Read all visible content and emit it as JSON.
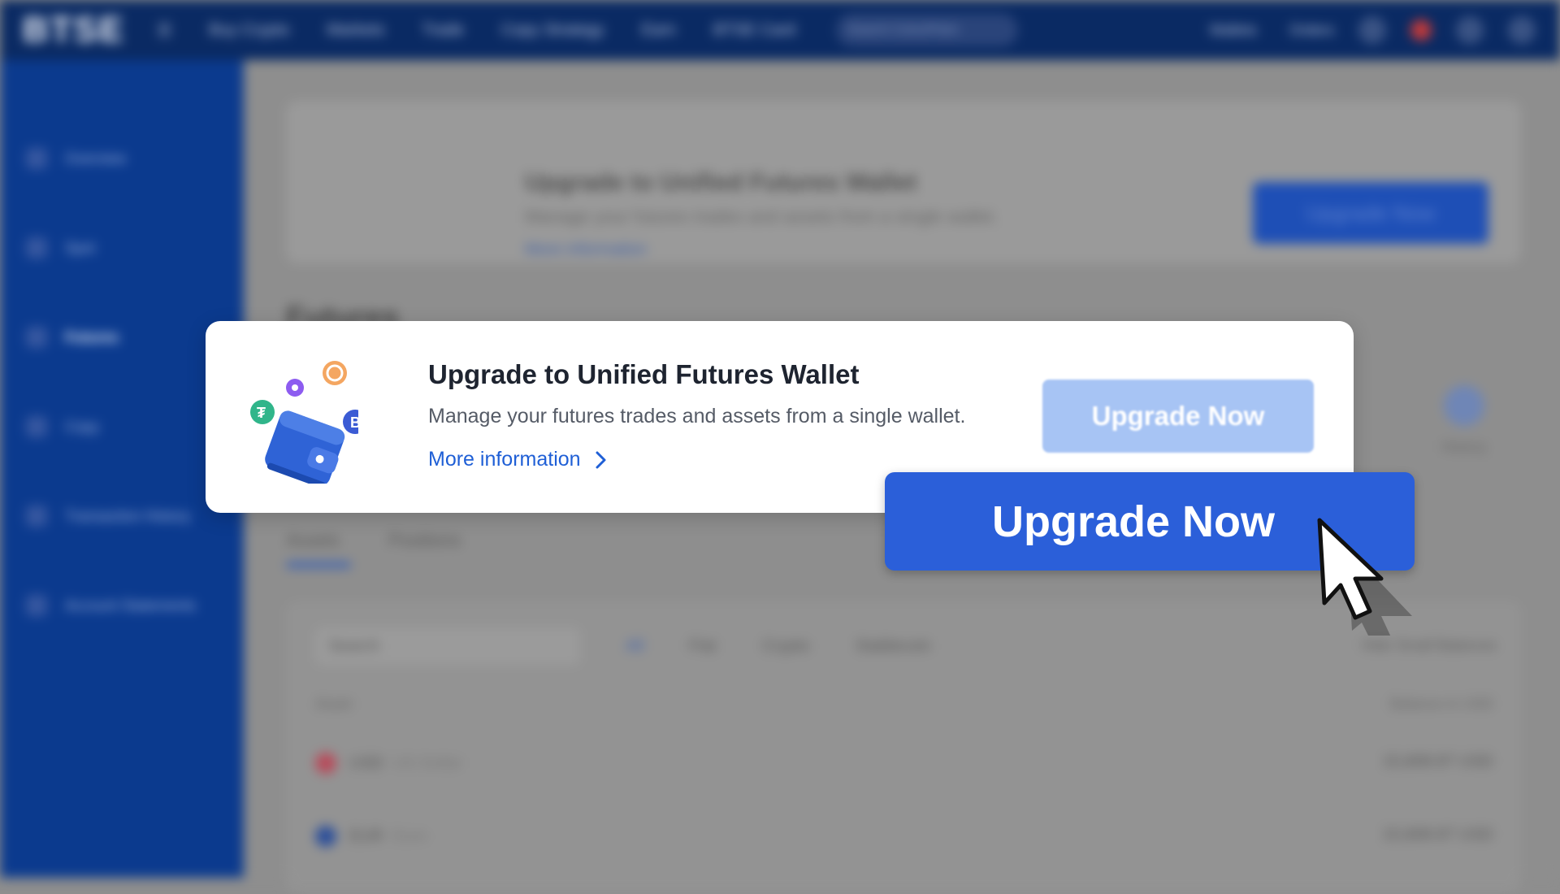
{
  "topbar": {
    "logo": "BTSE",
    "nav": [
      "Buy Crypto",
      "Markets",
      "Trade",
      "Copy Strategy",
      "Earn",
      "BTSE Card"
    ],
    "search_placeholder": "Search Coins/Pairs",
    "right": [
      "Wallets",
      "Orders"
    ]
  },
  "sidebar": {
    "items": [
      {
        "label": "Overview"
      },
      {
        "label": "Spot"
      },
      {
        "label": "Futures"
      },
      {
        "label": "Copy"
      },
      {
        "label": "Transaction History"
      },
      {
        "label": "Account Statements"
      }
    ],
    "active_index": 2
  },
  "background": {
    "card_title": "Upgrade to Unified Futures Wallet",
    "card_sub": "Manage your futures trades and assets from a single wallet.",
    "card_link": "More information",
    "card_button": "Upgrade Now",
    "heading": "Futures",
    "tabs": [
      "Assets",
      "Positions"
    ],
    "history_label": "History",
    "filter": {
      "search_placeholder": "Search",
      "chips": [
        "All",
        "Fiat",
        "Crypto",
        "Stablecoin"
      ],
      "hide_label": "Hide Small Balances"
    },
    "col_asset": "Asset",
    "col_balance": "Balance in USD",
    "rows": [
      {
        "asset": "USD",
        "name": "US Dollar",
        "value": "15,608.87 USD"
      },
      {
        "asset": "EUR",
        "name": "Euro",
        "value": "15,608.87 USD"
      }
    ]
  },
  "popup": {
    "title": "Upgrade to Unified Futures Wallet",
    "subtitle": "Manage your futures trades and assets from a single wallet.",
    "link": "More information",
    "button": "Upgrade Now"
  },
  "zoom": {
    "button": "Upgrade Now"
  },
  "colors": {
    "accent": "#2b5fd9",
    "link": "#1f5fd6",
    "sidebar": "#0b3a8e",
    "topbar": "#0a2a63"
  }
}
